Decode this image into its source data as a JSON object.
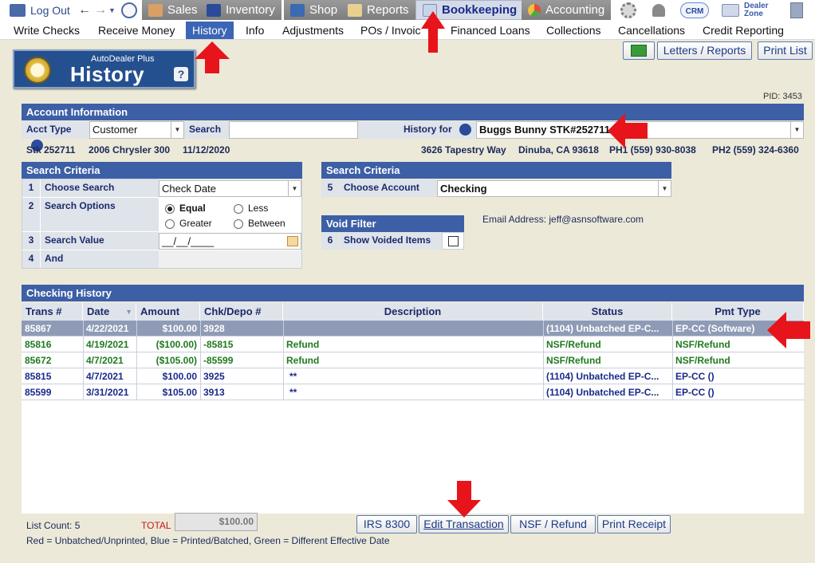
{
  "topnav": {
    "logout": "Log Out",
    "sales": "Sales",
    "inventory": "Inventory",
    "shop": "Shop",
    "reports": "Reports",
    "bookkeeping": "Bookkeeping",
    "accounting": "Accounting",
    "crm": "CRM",
    "dealer_zone_1": "Dealer",
    "dealer_zone_2": "Zone"
  },
  "submenu": {
    "write_checks": "Write Checks",
    "receive_money": "Receive Money",
    "history": "History",
    "info": "Info",
    "adjustments": "Adjustments",
    "pos_invoices": "POs / Invoic",
    "financed_loans": "Financed Loans",
    "collections": "Collections",
    "cancellations": "Cancellations",
    "credit_reporting": "Credit Reporting"
  },
  "header": {
    "subtitle": "AutoDealer Plus",
    "title": "History",
    "help": "?",
    "letters_reports": "Letters / Reports",
    "print_list": "Print List",
    "pid": "PID: 3453"
  },
  "account": {
    "header": "Account Information",
    "acct_type_label": "Acct Type",
    "acct_type_value": "Customer",
    "search_label": "Search",
    "search_value": "",
    "history_for_label": "History for",
    "history_for_value": "Buggs Bunny  STK#252711",
    "stk": "Stk 252711",
    "vehicle": "2006 Chrysler 300",
    "date": "11/12/2020",
    "address": "3626 Tapestry Way",
    "city": "Dinuba, CA 93618",
    "ph1": "PH1 (559) 930-8038",
    "ph2": "PH2 (559) 324-6360"
  },
  "criteria_left": {
    "header": "Search Criteria",
    "n1": "1",
    "choose_search_label": "Choose Search",
    "choose_search_value": "Check Date",
    "n2": "2",
    "search_options_label": "Search Options",
    "opt_equal": "Equal",
    "opt_less": "Less",
    "opt_greater": "Greater",
    "opt_between": "Between",
    "n3": "3",
    "search_value_label": "Search Value",
    "search_value_placeholder": "__/__/____",
    "n4": "4",
    "and_label": "And"
  },
  "criteria_right": {
    "header": "Search Criteria",
    "n5": "5",
    "choose_account_label": "Choose Account",
    "choose_account_value": "Checking"
  },
  "void_filter": {
    "header": "Void Filter",
    "n6": "6",
    "show_voided_label": "Show Voided Items"
  },
  "email": "Email Address: jeff@asnsoftware.com",
  "history_table": {
    "header": "Checking History",
    "columns": [
      "Trans #",
      "Date",
      "Amount",
      "Chk/Depo #",
      "Description",
      "Status",
      "Pmt Type"
    ],
    "rows": [
      {
        "trans": "85867",
        "date": "4/22/2021",
        "amount": "$100.00",
        "chk": "3928",
        "desc": "",
        "status": "(1104) Unbatched EP-C...",
        "pmt": "EP-CC (Software)"
      },
      {
        "trans": "85816",
        "date": "4/19/2021",
        "amount": "($100.00)",
        "chk": "-85815",
        "desc": "Refund",
        "status": "NSF/Refund",
        "pmt": "NSF/Refund"
      },
      {
        "trans": "85672",
        "date": "4/7/2021",
        "amount": "($105.00)",
        "chk": "-85599",
        "desc": "Refund",
        "status": "NSF/Refund",
        "pmt": "NSF/Refund"
      },
      {
        "trans": "85815",
        "date": "4/7/2021",
        "amount": "$100.00",
        "chk": "3925",
        "desc": "**",
        "status": "(1104) Unbatched EP-C...",
        "pmt": "EP-CC ()"
      },
      {
        "trans": "85599",
        "date": "3/31/2021",
        "amount": "$105.00",
        "chk": "3913",
        "desc": "**",
        "status": "(1104) Unbatched EP-C...",
        "pmt": "EP-CC ()"
      }
    ]
  },
  "footer": {
    "list_count": "List Count: 5",
    "total_label": "TOTAL",
    "total_value": "$100.00",
    "irs_8300": "IRS 8300",
    "edit_transaction": "Edit Transaction",
    "nsf_refund": "NSF / Refund",
    "print_receipt": "Print Receipt",
    "legend": "Red = Unbatched/Unprinted, Blue = Printed/Batched, Green = Different Effective Date"
  },
  "colors": {
    "accent": "#3c5fa6",
    "arrow": "#e8141b",
    "green_row": "#1f7a1f",
    "blue_row": "#1a2a8a",
    "selected_row": "#8f9bb6"
  }
}
